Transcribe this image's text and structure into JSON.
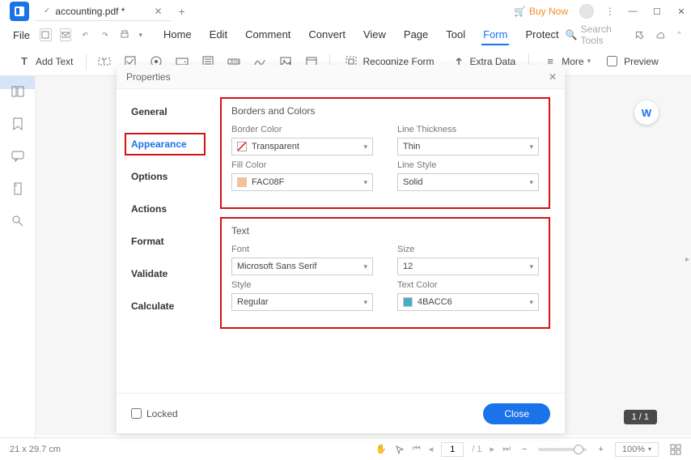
{
  "titlebar": {
    "tab_name": "accounting.pdf *",
    "buy_now": "Buy Now"
  },
  "menubar": {
    "file": "File",
    "items": [
      "Home",
      "Edit",
      "Comment",
      "Convert",
      "View",
      "Page",
      "Tool",
      "Form",
      "Protect"
    ],
    "active_index": 7,
    "search_placeholder": "Search Tools"
  },
  "toolbar": {
    "add_text": "Add Text",
    "recognize_form": "Recognize Form",
    "extra_data": "Extra Data",
    "more": "More",
    "preview": "Preview"
  },
  "dialog": {
    "title": "Properties",
    "tabs": [
      "General",
      "Appearance",
      "Options",
      "Actions",
      "Format",
      "Validate",
      "Calculate"
    ],
    "selected_tab_index": 1,
    "sections": {
      "borders": {
        "title": "Borders and Colors",
        "border_color_label": "Border Color",
        "border_color_value": "Transparent",
        "line_thickness_label": "Line Thickness",
        "line_thickness_value": "Thin",
        "fill_color_label": "Fill Color",
        "fill_color_value": "FAC08F",
        "fill_color_hex": "#FAC08F",
        "line_style_label": "Line Style",
        "line_style_value": "Solid"
      },
      "text": {
        "title": "Text",
        "font_label": "Font",
        "font_value": "Microsoft Sans Serif",
        "size_label": "Size",
        "size_value": "12",
        "style_label": "Style",
        "style_value": "Regular",
        "text_color_label": "Text Color",
        "text_color_value": "4BACC6",
        "text_color_hex": "#4BACC6"
      }
    },
    "locked_label": "Locked",
    "close_button": "Close"
  },
  "statusbar": {
    "dimensions": "21 x 29.7 cm",
    "page_current": "1",
    "page_total": "/ 1",
    "zoom": "100%",
    "page_badge": "1 / 1"
  }
}
